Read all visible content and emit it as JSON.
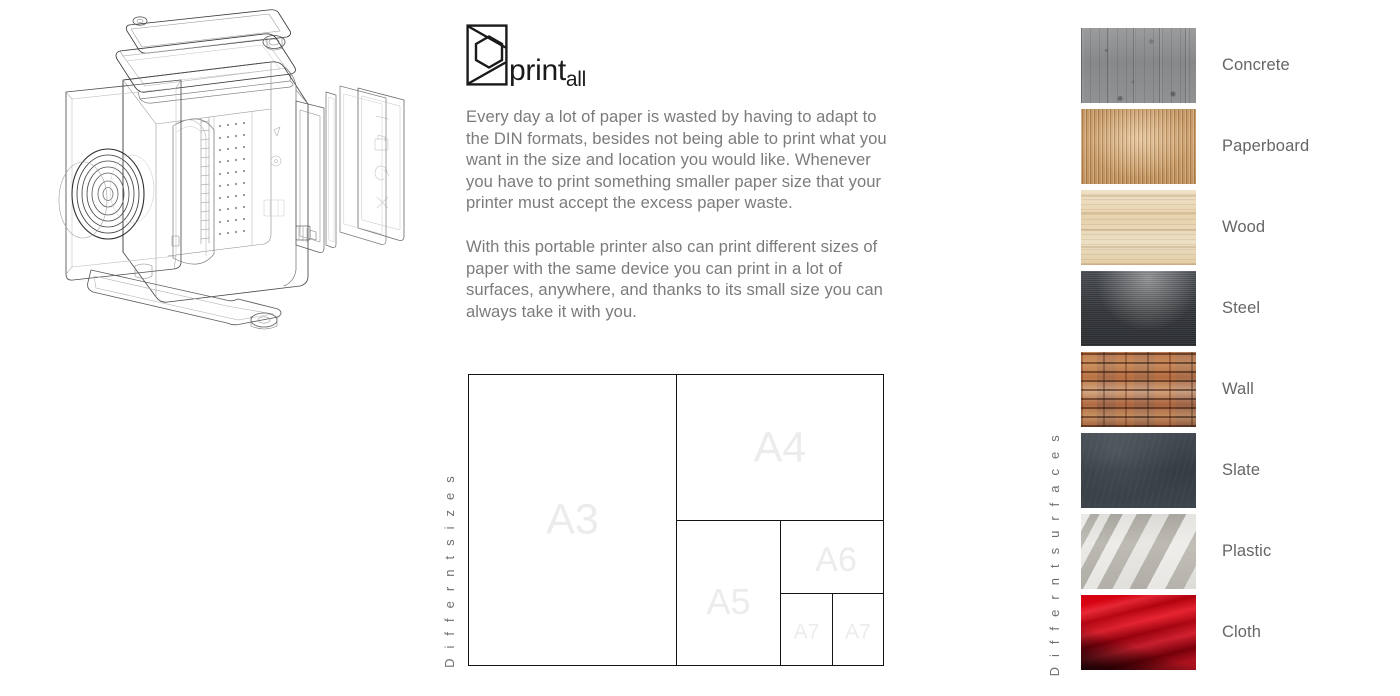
{
  "brand": {
    "mark_icon": "printall-hexagon-logo",
    "name_main": "print",
    "name_sub": "all"
  },
  "description": {
    "paragraph_one": "Every day a lot of paper is wasted by having to adapt to the DIN formats, besides not being able to print what you want in the size and location you would like. Whenever you have to print something smaller paper size that your printer must accept the excess paper waste.",
    "paragraph_two": "With this portable printer also can print different sizes of paper with the same device you can print in a lot of surfaces, anywhere, and thanks to its small size you can always take it with you."
  },
  "product_illustration": {
    "icon": "exploded-printer-line-drawing",
    "caption": ""
  },
  "sizes": {
    "axis_label": "D i f f e r n t   s i z e s",
    "cells": [
      {
        "label": "A3"
      },
      {
        "label": "A4"
      },
      {
        "label": "A5"
      },
      {
        "label": "A6"
      },
      {
        "label": "A7"
      },
      {
        "label": "A7"
      }
    ]
  },
  "surfaces": {
    "axis_label": "D i f f e r n t   s u r f a c e s",
    "items": [
      {
        "name": "Concrete",
        "swatch": "tex-concrete",
        "color": "#8e9091"
      },
      {
        "name": "Paperboard",
        "swatch": "tex-paperboard",
        "color": "#c08f55"
      },
      {
        "name": "Wood",
        "swatch": "tex-wood",
        "color": "#e7d4b4"
      },
      {
        "name": "Steel",
        "swatch": "tex-steel",
        "color": "#3b3e41"
      },
      {
        "name": "Wall",
        "swatch": "tex-wall",
        "color": "#9d6a4c"
      },
      {
        "name": "Slate",
        "swatch": "tex-slate",
        "color": "#3a4149"
      },
      {
        "name": "Plastic",
        "swatch": "tex-plastic",
        "color": "#c9c6be"
      },
      {
        "name": "Cloth",
        "swatch": "tex-cloth",
        "color": "#c40013"
      }
    ]
  },
  "theme": {
    "background": "#ffffff",
    "text_color": "#6e6e6e",
    "body_text_color": "#7b7b7b",
    "heading_color": "#1a1a1a",
    "diagram_stroke": "#141414",
    "diagram_label_color": "#ececec"
  }
}
